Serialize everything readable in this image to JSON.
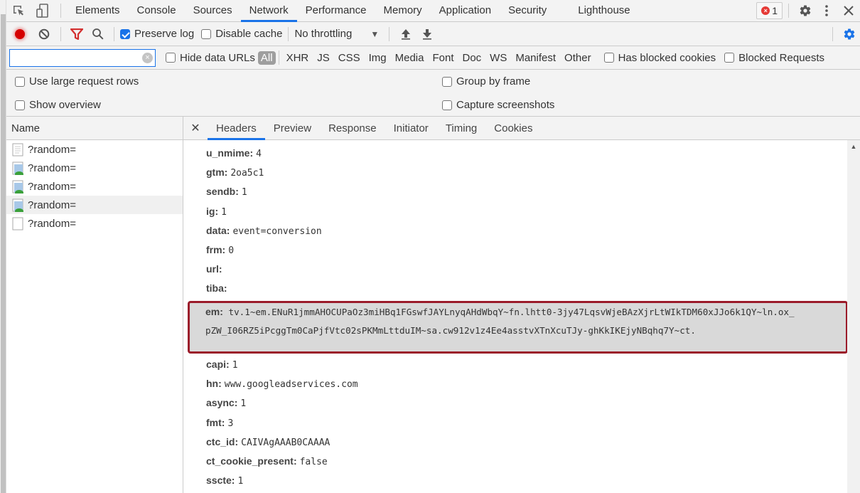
{
  "tabbar": {
    "tabs": [
      "Elements",
      "Console",
      "Sources",
      "Network",
      "Performance",
      "Memory",
      "Application",
      "Security",
      "Lighthouse"
    ],
    "active_tab": "Network",
    "error_count": "1"
  },
  "toolbar": {
    "preserve_log_label": "Preserve log",
    "preserve_log_checked": true,
    "disable_cache_label": "Disable cache",
    "disable_cache_checked": false,
    "throttling_value": "No throttling"
  },
  "filterbar": {
    "filter_value": "",
    "hide_data_urls_label": "Hide data URLs",
    "types": [
      "All",
      "XHR",
      "JS",
      "CSS",
      "Img",
      "Media",
      "Font",
      "Doc",
      "WS",
      "Manifest",
      "Other"
    ],
    "active_type": "All",
    "has_blocked_cookies_label": "Has blocked cookies",
    "blocked_requests_label": "Blocked Requests"
  },
  "options": {
    "use_large_rows": "Use large request rows",
    "show_overview": "Show overview",
    "group_by_frame": "Group by frame",
    "capture_screenshots": "Capture screenshots"
  },
  "sidebar": {
    "header": "Name",
    "requests": [
      {
        "name": "?random=",
        "icon": "document"
      },
      {
        "name": "?random=",
        "icon": "image"
      },
      {
        "name": "?random=",
        "icon": "image"
      },
      {
        "name": "?random=",
        "icon": "image"
      },
      {
        "name": "?random=",
        "icon": "blank"
      }
    ]
  },
  "detail": {
    "tabs": [
      "Headers",
      "Preview",
      "Response",
      "Initiator",
      "Timing",
      "Cookies"
    ],
    "active_tab": "Headers",
    "params_top": [
      {
        "key": "u_nmime:",
        "value": "4"
      },
      {
        "key": "gtm:",
        "value": "2oa5c1"
      },
      {
        "key": "sendb:",
        "value": "1"
      },
      {
        "key": "ig:",
        "value": "1"
      },
      {
        "key": "data:",
        "value": "event=conversion"
      },
      {
        "key": "frm:",
        "value": "0"
      },
      {
        "key": "url:",
        "value": ""
      },
      {
        "key": "tiba:",
        "value": ""
      }
    ],
    "em": {
      "key": "em:",
      "line1": "tv.1~em.ENuR1jmmAHOCUPaOz3miHBq1FGswfJAYLnyqAHdWbqY~fn.lhtt0-3jy47LqsvWjeBAzXjrLtWIkTDM60xJJo6k1QY~ln.ox_",
      "line2": "pZW_I06RZ5iPcggTm0CaPjfVtc02sPKMmLttduIM~sa.cw912v1z4Ee4asstvXTnXcuTJy-ghKkIKEjyNBqhq7Y~ct."
    },
    "params_bottom": [
      {
        "key": "capi:",
        "value": "1"
      },
      {
        "key": "hn:",
        "value": "www.googleadservices.com"
      },
      {
        "key": "async:",
        "value": "1"
      },
      {
        "key": "fmt:",
        "value": "3"
      },
      {
        "key": "ctc_id:",
        "value": "CAIVAgAAAB0CAAAA"
      },
      {
        "key": "ct_cookie_present:",
        "value": "false"
      },
      {
        "key": "sscte:",
        "value": "1"
      }
    ]
  },
  "colors": {
    "accent": "#1a73e8",
    "record": "#d50000",
    "filter": "#d32f2f",
    "highlight_border": "#9b1b2a",
    "highlight_bg": "#d9d9d9"
  }
}
